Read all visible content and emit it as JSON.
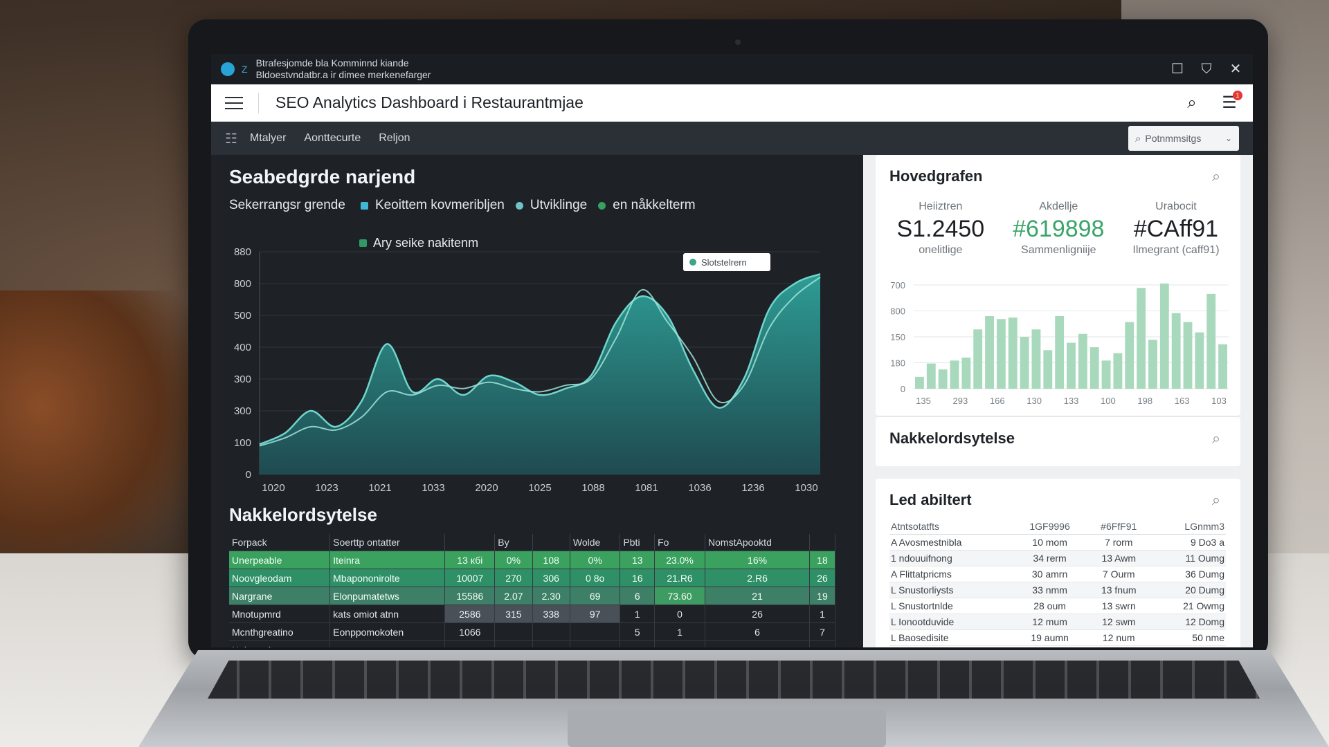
{
  "window": {
    "title_line1": "Btrafesjomde bla Komminnd kiande",
    "title_line2": "Bldoestvndatbr.a ir dimee merkenefarger",
    "app_sub_glyph": "Z"
  },
  "header": {
    "title": "SEO Analytics Dashboard i Restaurantmjae",
    "notification_count": "1"
  },
  "nav": {
    "items": [
      "Mtalyer",
      "Aonttecurte",
      "Reljon"
    ],
    "search_placeholder": "Potnmmsitgs"
  },
  "main": {
    "section_title": "Seabedgrde narjend",
    "legend_lead": "Sekerrangsr grende",
    "legend": [
      {
        "label": "Keoittem kovmeribljen",
        "color": "#3fb7d6"
      },
      {
        "label": "Utviklinge",
        "color": "#6fc3c7"
      },
      {
        "label": "en nåkkelterm",
        "color": "#36a163"
      },
      {
        "label": "Ary seike nakitenm",
        "color": "#2f9a66"
      }
    ],
    "tooltip": "Slotstelrern",
    "keywords_title": "Nakkelordsytelse",
    "keywords_table": {
      "headers": [
        "Forpack",
        "Soerttp ontatter",
        "",
        "By",
        "",
        "Wolde",
        "Pbti",
        "Fo",
        "NomstApooktd",
        ""
      ],
      "rows": [
        [
          "Unerpeable",
          "Iteinra",
          "13 кбі",
          "0%",
          "108",
          "0%",
          "13",
          "23.0%",
          "16%",
          "18"
        ],
        [
          "Noovgleodam",
          "Mbapononirolte",
          "10007",
          "270",
          "306",
          "0 8o",
          "16",
          "21.R6",
          "2.R6",
          "26"
        ],
        [
          "Nargrane",
          "Elonpumatetws",
          "15586",
          "2.07",
          "2.30",
          "69",
          "6",
          "73.60",
          "21",
          "19"
        ],
        [
          "Mnotupmrd",
          "kats omiot atnn",
          "2586",
          "315",
          "338",
          "97",
          "1",
          "0",
          "26",
          "1"
        ],
        [
          "Mcnthgreatino",
          "Eonppomokoten",
          "1066",
          "",
          "",
          "",
          "5",
          "1",
          "6",
          "7"
        ],
        [
          "Nuimprpite",
          "",
          "",
          "",
          "",
          "",
          "",
          "",
          "",
          ""
        ]
      ]
    }
  },
  "right": {
    "card1_title": "Hovedgrafen",
    "kpis": [
      {
        "label": "Heiiztren",
        "value": "S1.2450",
        "sub": "onelitlige"
      },
      {
        "label": "Akdellje",
        "value": "#619898",
        "sub": "Sammenligniije"
      },
      {
        "label": "Urabocit",
        "value": "#CAff91",
        "sub": "Ilmegrant (caff91)"
      }
    ],
    "card2_title": "Nakkelordsytelse",
    "card3_title": "Led abiltert",
    "led_table": {
      "headers": [
        "Atntsotatfts",
        "1GF9996",
        "#6FfF91",
        "LGnmm3"
      ],
      "rows": [
        [
          "A Avosmestnibla",
          "10 mom",
          "7 rorm",
          "9 Do3 a"
        ],
        [
          "1 ndouuifnong",
          "34 rerm",
          "13 Awm",
          "11 Oumg"
        ],
        [
          "A Flittatpricms",
          "30 amrn",
          "7 Ourm",
          "36 Dumg"
        ],
        [
          "L Snustorliysts",
          "33 nmm",
          "13 fnum",
          "20 Dumg"
        ],
        [
          "L Snustortnlde",
          "28 oum",
          "13 swrn",
          "21 Owmg"
        ],
        [
          "L Ionootduvide",
          "12 mum",
          "12 swm",
          "12 Domg"
        ],
        [
          "L Baosedisite",
          "19 aumn",
          "12 num",
          "50 nme"
        ]
      ]
    }
  },
  "chart_data": [
    {
      "type": "area",
      "title": "Seabedgrde narjend",
      "x_ticks": [
        "1020",
        "1023",
        "1021",
        "1033",
        "2020",
        "1025",
        "1088",
        "1081",
        "1036",
        "1236",
        "1030"
      ],
      "y_ticks": [
        "0",
        "100",
        "300",
        "300",
        "400",
        "500",
        "800",
        "880"
      ],
      "ylim": [
        0,
        700
      ],
      "series": [
        {
          "name": "Keoittem kovmeribljen",
          "values": [
            95,
            130,
            200,
            150,
            230,
            410,
            260,
            300,
            250,
            310,
            290,
            250,
            270,
            310,
            480,
            560,
            500,
            330,
            210,
            300,
            520,
            600,
            630
          ]
        },
        {
          "name": "Utviklinge",
          "values": [
            90,
            115,
            150,
            140,
            180,
            260,
            250,
            280,
            270,
            290,
            270,
            260,
            280,
            300,
            430,
            580,
            480,
            370,
            230,
            280,
            460,
            560,
            620
          ]
        }
      ],
      "colors": {
        "area": "#2fa39a",
        "line": "#6fd6cc"
      }
    },
    {
      "type": "bar",
      "title": "Hovedgrafen",
      "x_ticks": [
        "135",
        "293",
        "166",
        "130",
        "133",
        "100",
        "198",
        "163",
        "103"
      ],
      "y_ticks": [
        "0",
        "180",
        "150",
        "800",
        "700"
      ],
      "ylim": [
        0,
        700
      ],
      "values": [
        80,
        170,
        130,
        190,
        210,
        400,
        490,
        470,
        480,
        350,
        400,
        260,
        490,
        310,
        370,
        280,
        190,
        240,
        450,
        680,
        330,
        710,
        510,
        450,
        380,
        640,
        300
      ],
      "color": "#a8d9bd"
    }
  ]
}
